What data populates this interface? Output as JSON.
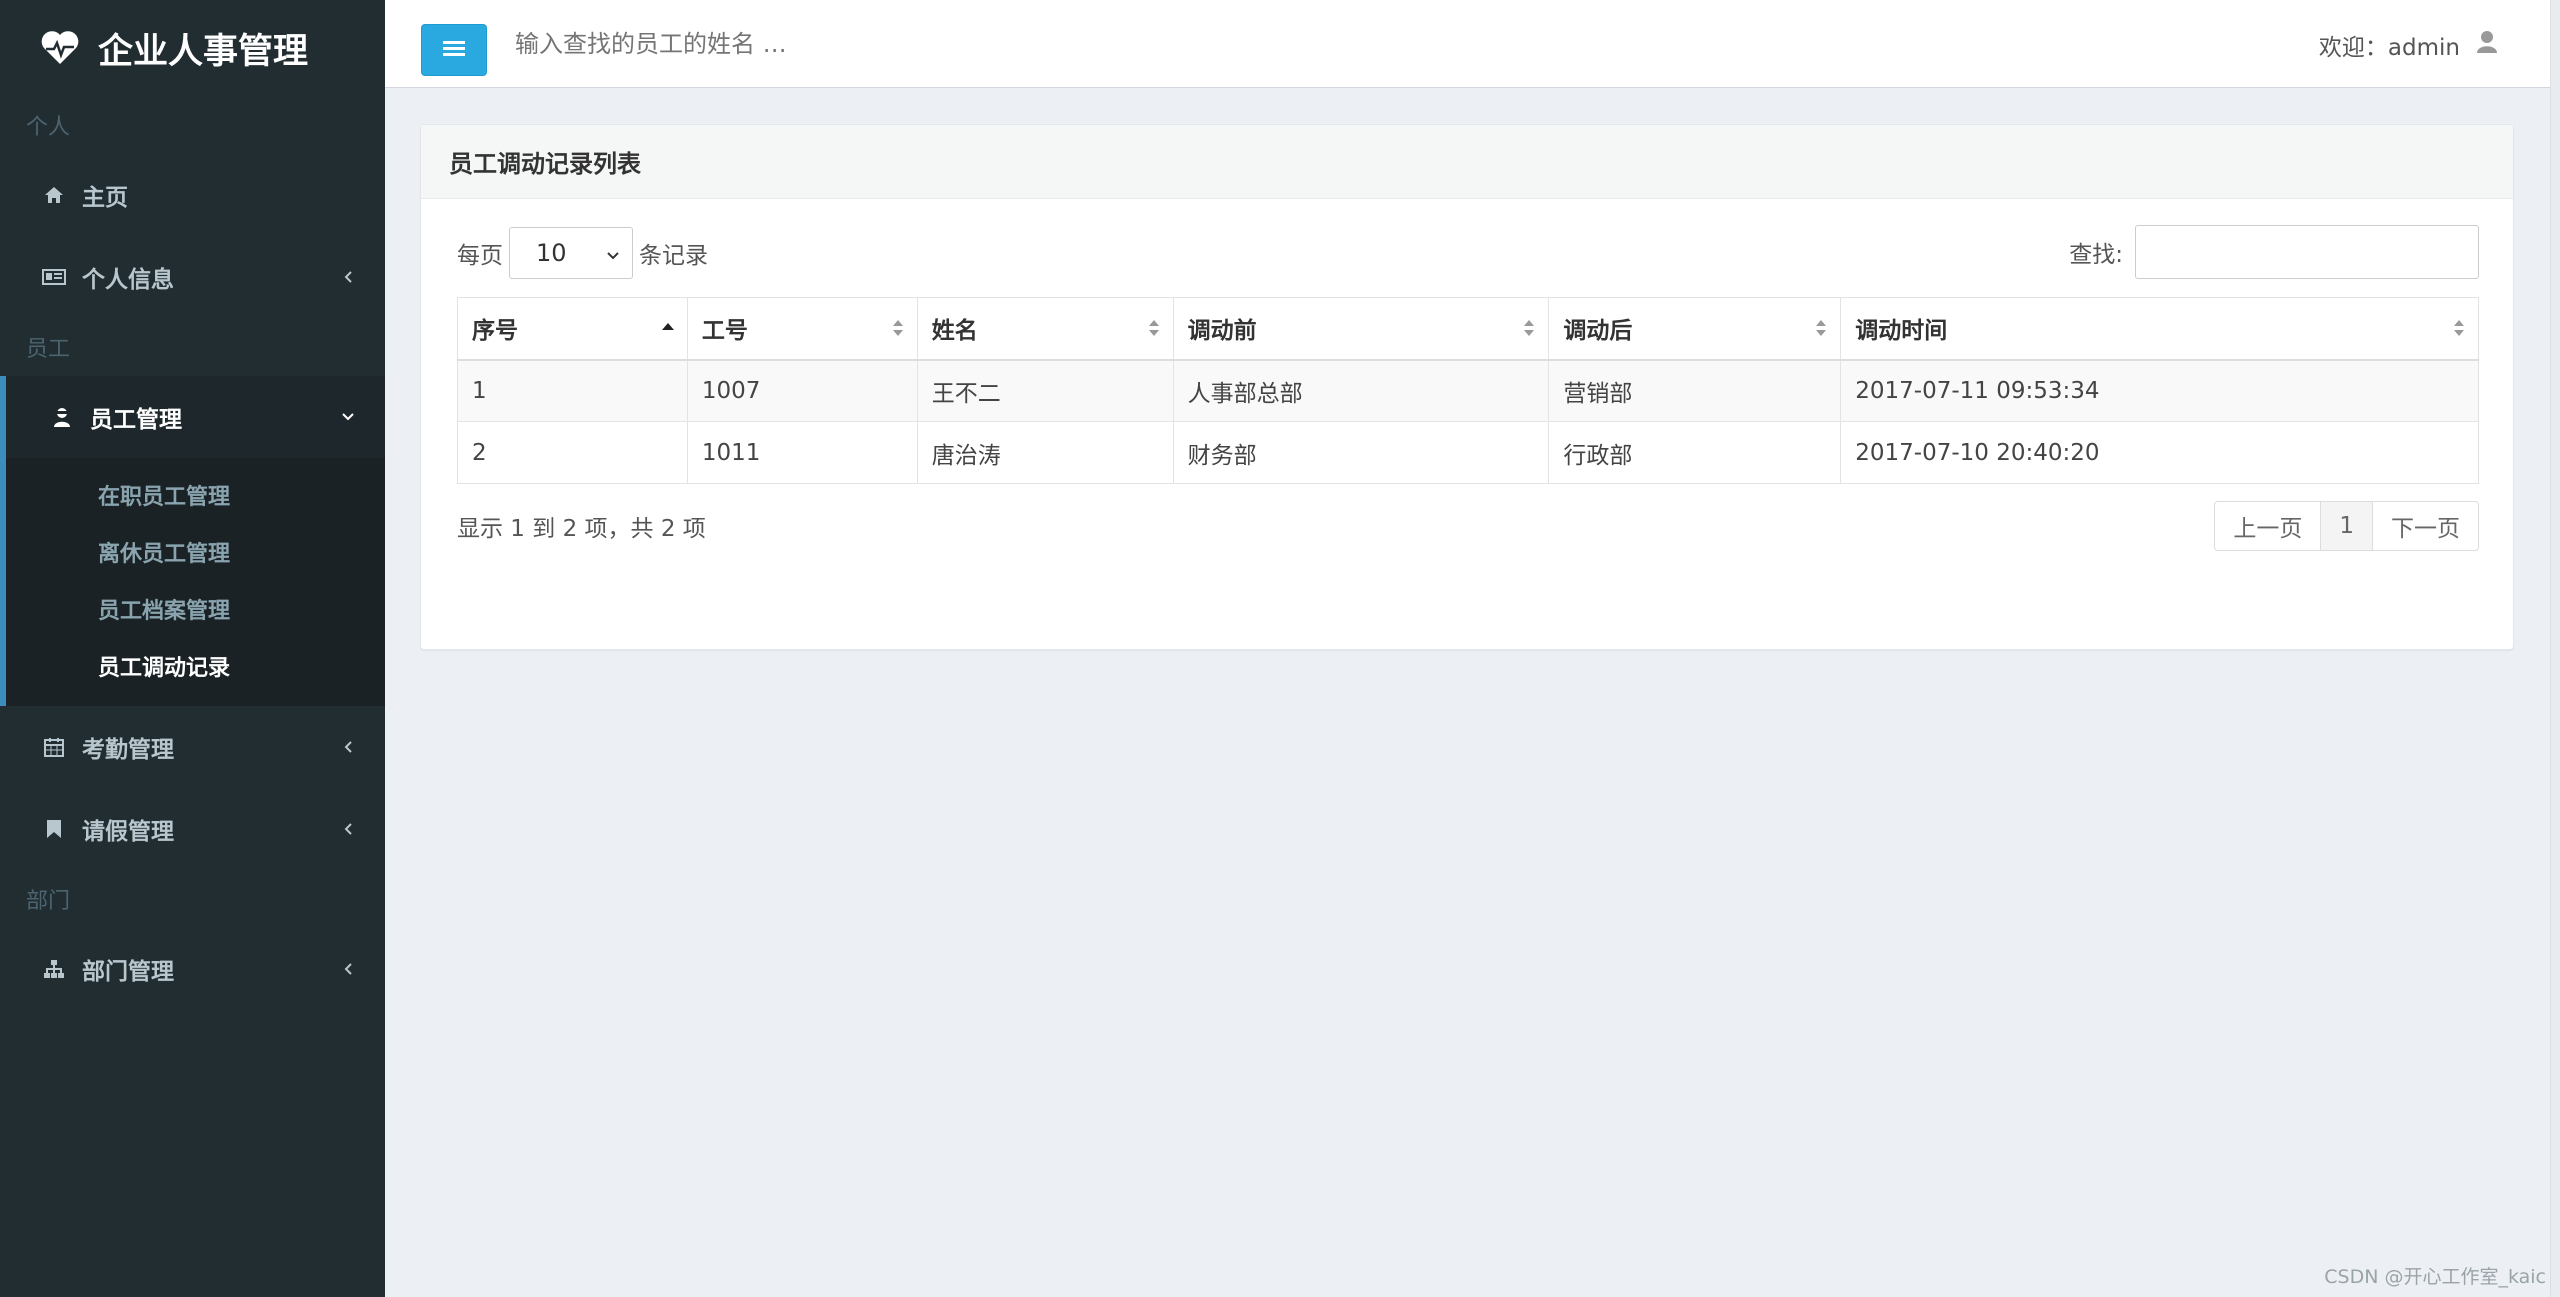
{
  "app": {
    "title": "企业人事管理"
  },
  "sidebar": {
    "sections": {
      "personal": "个人",
      "employee": "员工",
      "department": "部门"
    },
    "items": {
      "home": "主页",
      "profile": "个人信息",
      "employee_mgmt": "员工管理",
      "attendance": "考勤管理",
      "leave": "请假管理",
      "dept_mgmt": "部门管理"
    },
    "submenu": [
      "在职员工管理",
      "离休员工管理",
      "员工档案管理",
      "员工调动记录"
    ]
  },
  "header": {
    "search_placeholder": "输入查找的员工的姓名 …",
    "welcome": "欢迎：admin"
  },
  "panel": {
    "title": "员工调动记录列表",
    "per_page_prefix": "每页",
    "per_page_value": "10",
    "per_page_suffix": "条记录",
    "find_label": "查找:",
    "columns": [
      "序号",
      "工号",
      "姓名",
      "调动前",
      "调动后",
      "调动时间"
    ],
    "rows": [
      [
        "1",
        "1007",
        "王不二",
        "人事部总部",
        "营销部",
        "2017-07-11 09:53:34"
      ],
      [
        "2",
        "1011",
        "唐治涛",
        "财务部",
        "行政部",
        "2017-07-10 20:40:20"
      ]
    ],
    "info": "显示 1 到 2 项，共 2 项",
    "pagination": {
      "prev": "上一页",
      "current": "1",
      "next": "下一页"
    }
  },
  "watermark": "CSDN @开心工作室_kaic",
  "colors": {
    "sidebar_bg": "#222d32",
    "accent": "#29a9df",
    "body_bg": "#ecf0f5"
  }
}
